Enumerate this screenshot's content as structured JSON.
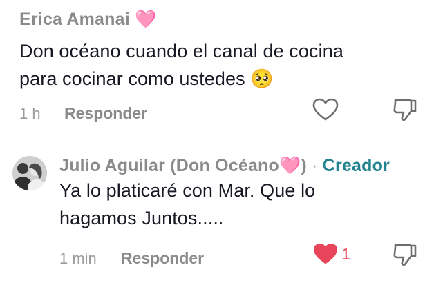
{
  "comments": [
    {
      "username": "Erica Amanai",
      "heart_emoji": "🩷",
      "text_line1": "Don océano cuando el canal de cocina",
      "text_line2": "para cocinar como ustedes",
      "emoji": "🥺",
      "time": "1 h",
      "reply_label": "Responder",
      "liked": false,
      "like_icon": "heart-outline-icon",
      "dislike_icon": "thumbs-down-icon"
    },
    {
      "username": "Julio Aguilar (Don Océano",
      "heart_emoji": "🩷",
      "username_close": ")",
      "separator": "·",
      "badge": "Creador",
      "text_line1": "Ya lo platicaré con Mar. Que lo",
      "text_line2": "hagamos Juntos.....",
      "time": "1 min",
      "reply_label": "Responder",
      "liked": true,
      "likes": "1",
      "like_icon": "heart-filled-icon",
      "dislike_icon": "thumbs-down-icon"
    }
  ],
  "colors": {
    "creator_badge": "#20838f",
    "liked_heart": "#e9455a",
    "text": "#161823",
    "muted": "#8a8a8a",
    "pink_heart_emoji": "#f4a0a8"
  }
}
